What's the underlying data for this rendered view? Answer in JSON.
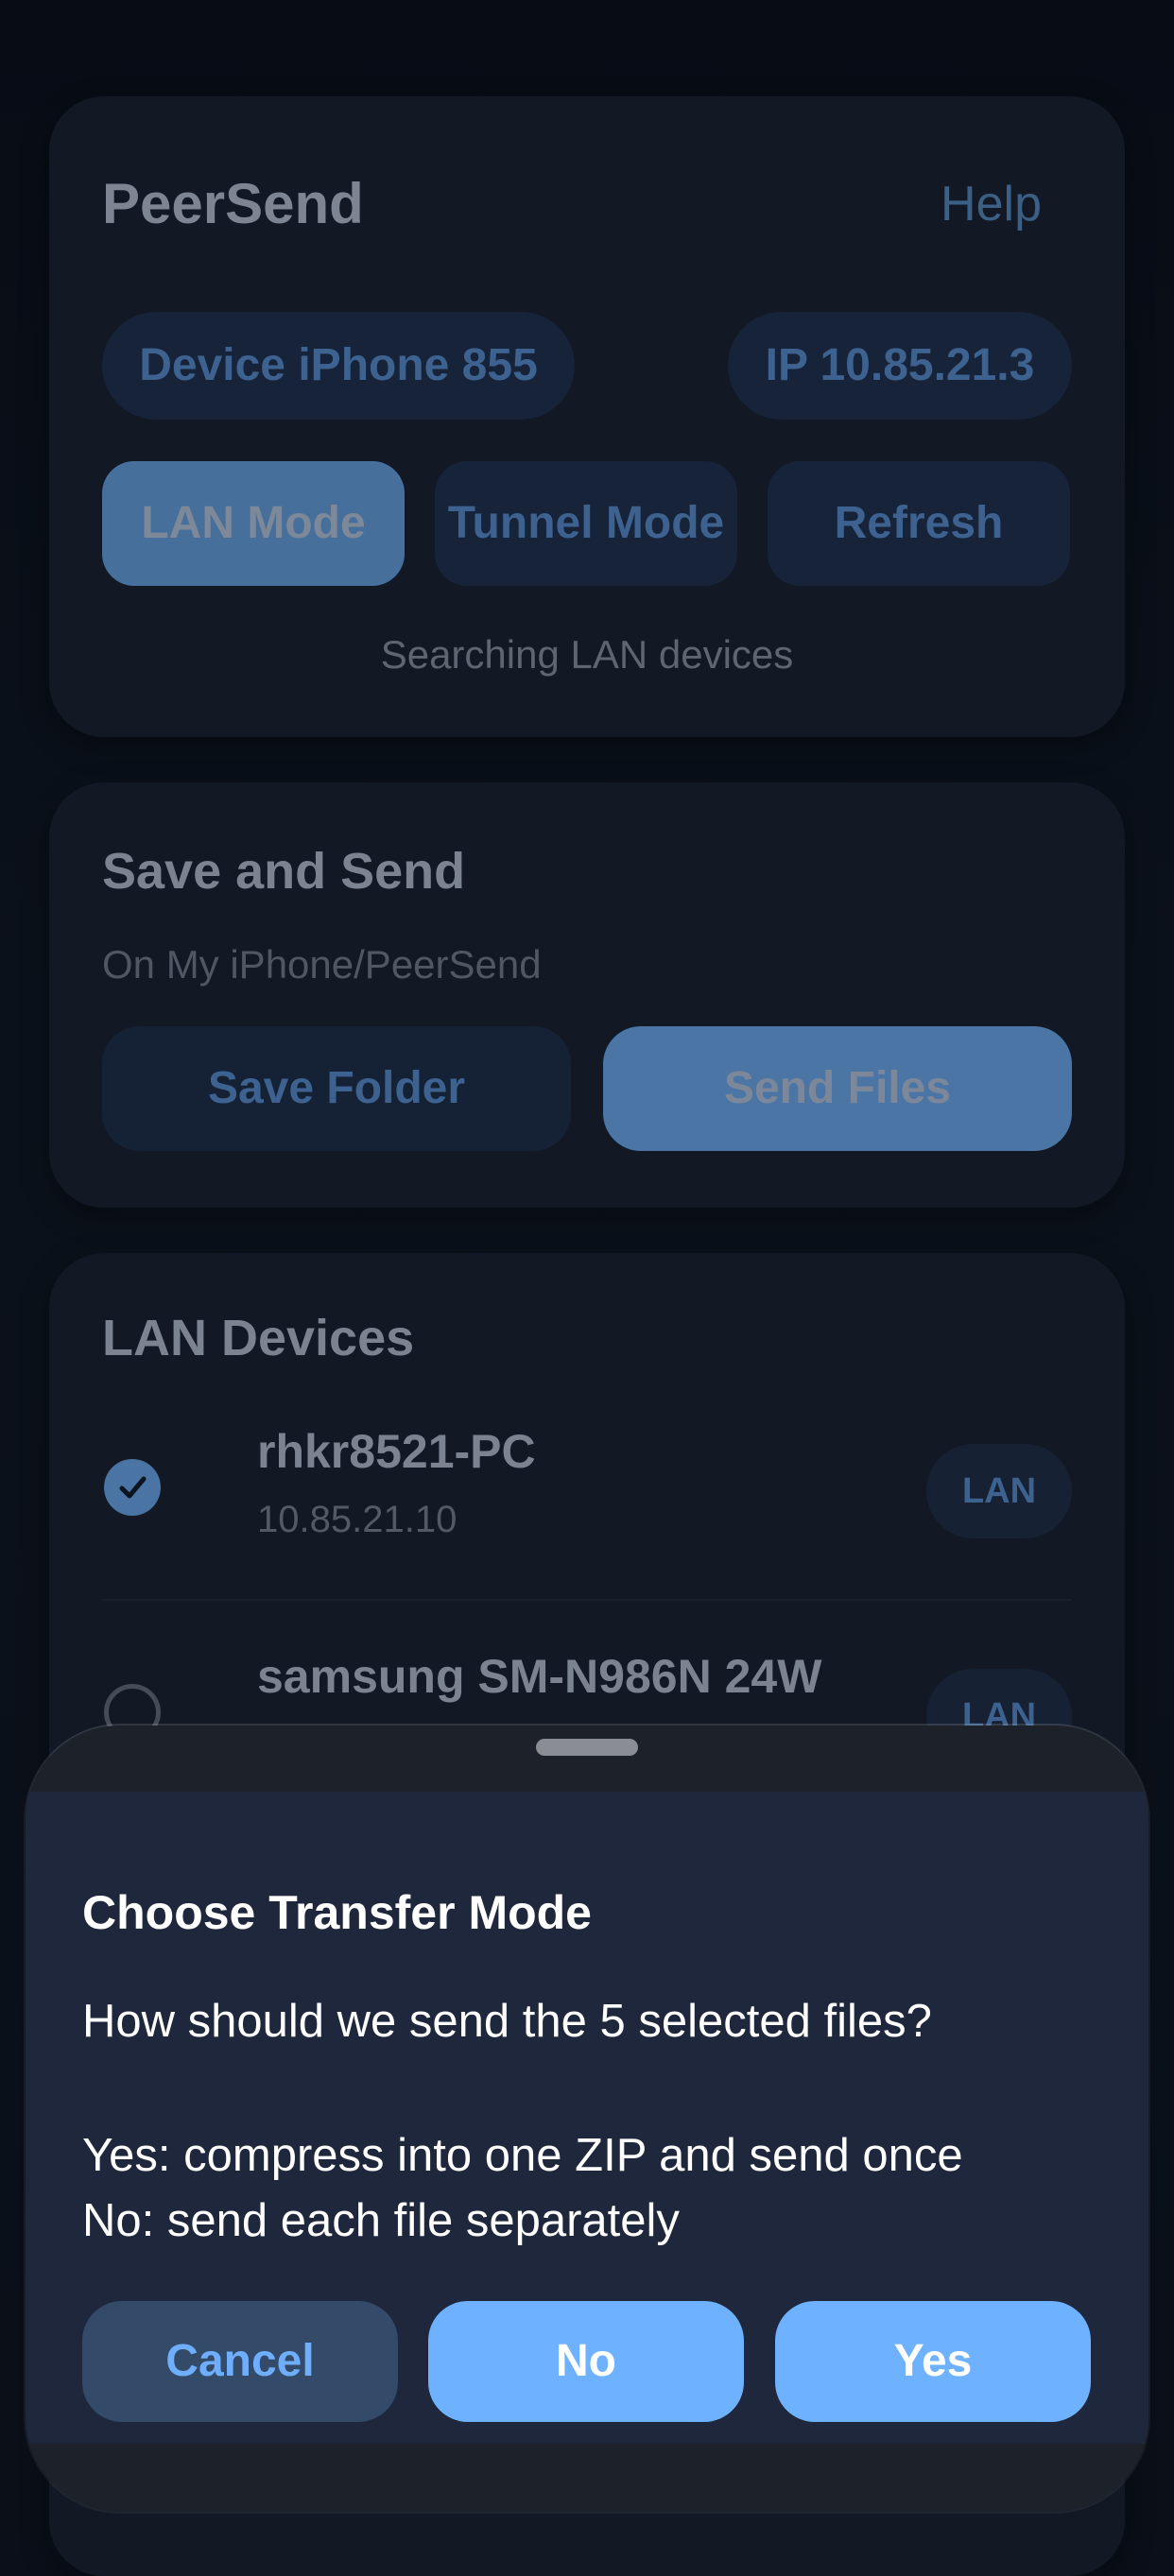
{
  "header": {
    "app_title": "PeerSend",
    "help_label": "Help",
    "device_pill": "Device iPhone 855",
    "ip_pill": "IP 10.85.21.3",
    "mode_buttons": {
      "lan": "LAN Mode",
      "tunnel": "Tunnel Mode",
      "refresh": "Refresh"
    },
    "status": "Searching LAN devices"
  },
  "save_send": {
    "title": "Save and Send",
    "path": "On My iPhone/PeerSend",
    "save_folder_label": "Save Folder",
    "send_files_label": "Send Files"
  },
  "devices": {
    "title": "LAN Devices",
    "items": [
      {
        "name": "rhkr8521-PC",
        "ip": "10.85.21.10",
        "badge": "LAN",
        "selected": true
      },
      {
        "name": "samsung SM-N986N 24W",
        "ip": "",
        "badge": "LAN",
        "selected": false
      }
    ]
  },
  "dialog": {
    "title": "Choose Transfer Mode",
    "message_line_1": "How should we send the 5 selected files?",
    "message_line_2": "Yes: compress into one ZIP and send once",
    "message_line_3": "No: send each file separately",
    "cancel_label": "Cancel",
    "no_label": "No",
    "yes_label": "Yes"
  },
  "icons": {
    "selected_radio": "checkmark-circle-icon",
    "unselected_radio": "empty-circle-icon",
    "sheet_grabber": "grabber-handle"
  },
  "colors": {
    "accent": "#6eb2ff",
    "accent_dim": "#4a74a3",
    "card_background": "#121925",
    "sheet_background": "#1e273b"
  }
}
